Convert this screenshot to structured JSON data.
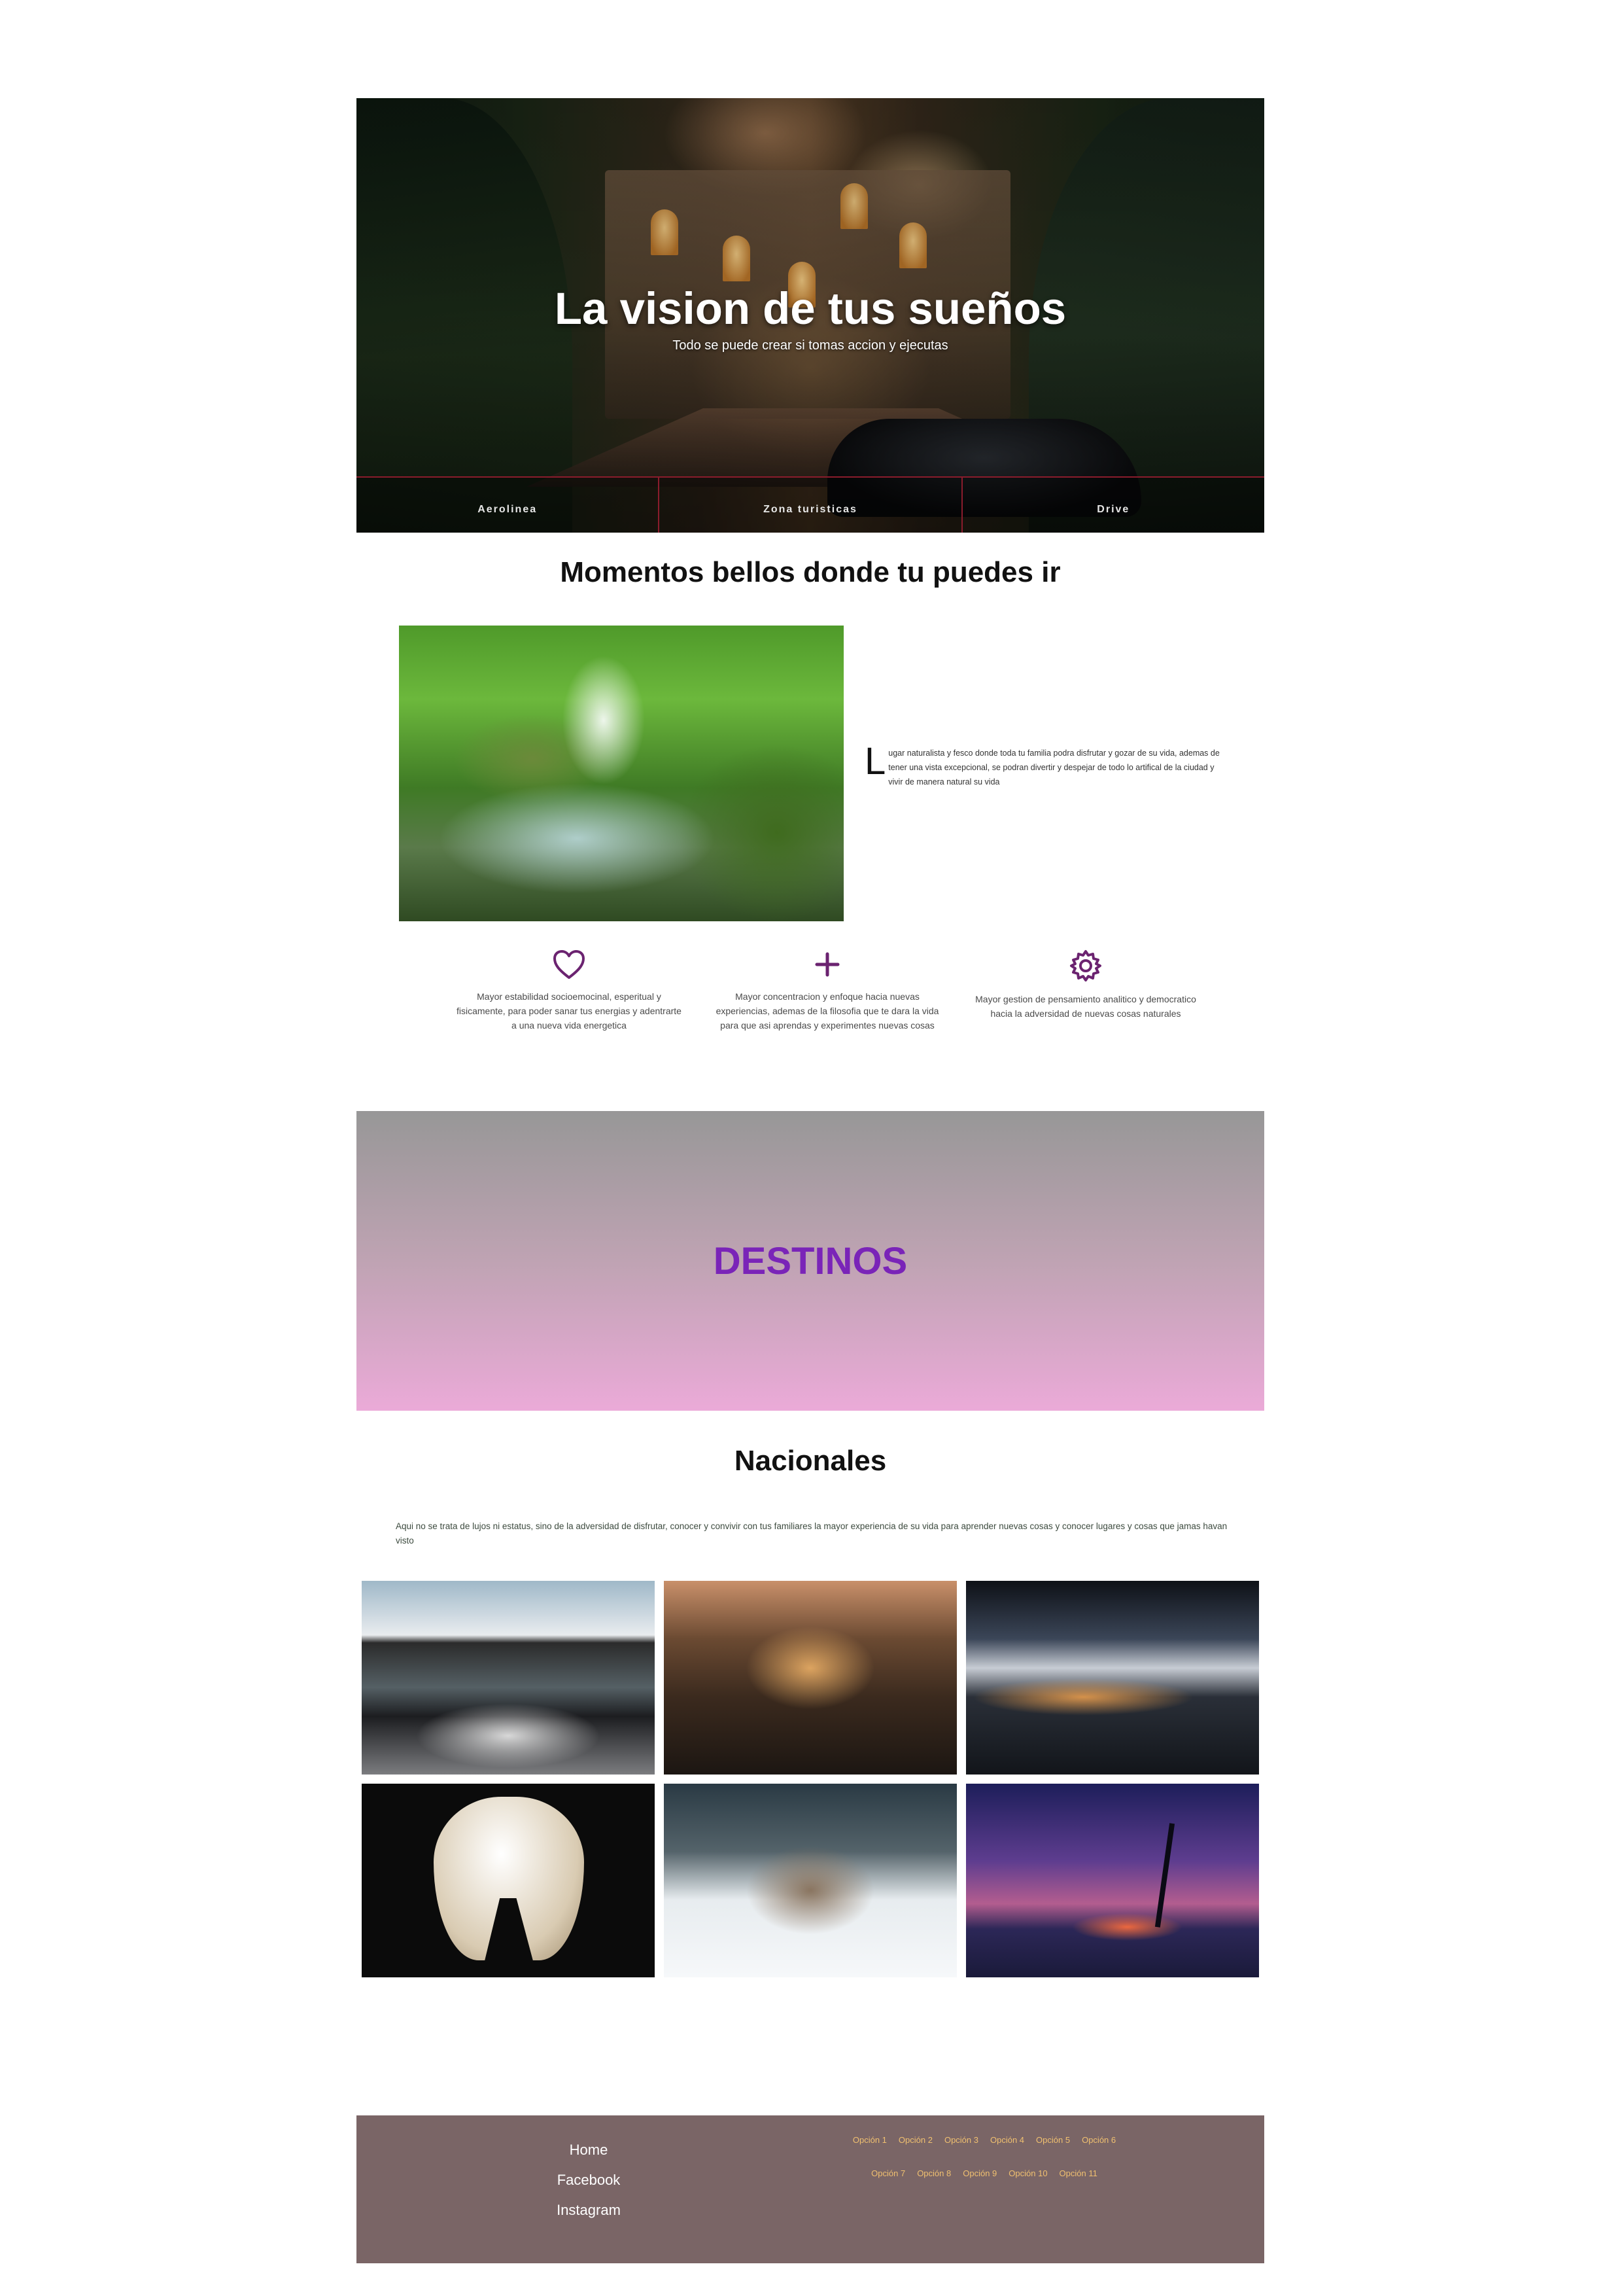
{
  "hero": {
    "title": "La vision de tus sueños",
    "subtitle": "Todo se puede crear si tomas accion y ejecutas",
    "nav": [
      "Aerolinea",
      "Zona turisticas",
      "Drive"
    ]
  },
  "momentos": {
    "title": "Momentos bellos donde tu puedes ir",
    "dropcap": "L",
    "text": "ugar naturalista y fesco donde toda tu familia podra disfrutar y gozar de su vida, ademas de tener una vista excepcional, se podran divertir y despejar de todo lo artifical de la ciudad y vivir de manera natural su vida"
  },
  "features": [
    {
      "icon": "heart-icon",
      "text": "Mayor estabilidad socioemocinal, esperitual y fisicamente, para poder sanar tus energias y adentrarte a una nueva vida energetica"
    },
    {
      "icon": "plus-icon",
      "text": "Mayor concentracion y enfoque hacia nuevas experiencias, ademas de la filosofia que te dara la vida para que asi aprendas y experimentes nuevas cosas"
    },
    {
      "icon": "gear-icon",
      "text": "Mayor gestion de pensamiento analitico y democratico hacia la adversidad de nuevas cosas naturales"
    }
  ],
  "destinos": {
    "title": "DESTINOS"
  },
  "nacionales": {
    "title": "Nacionales",
    "text": "Aqui no se trata de lujos ni estatus, sino de la adversidad de disfrutar, conocer y convivir con tus familiares la mayor experiencia de su vida para aprender nuevas cosas y conocer lugares y cosas que jamas havan visto"
  },
  "footer": {
    "links": [
      "Home",
      "Facebook",
      "Instagram"
    ],
    "options_row1": [
      "Opción 1",
      "Opción 2",
      "Opción 3",
      "Opción 4",
      "Opción 5",
      "Opción 6"
    ],
    "options_row2": [
      "Opción 7",
      "Opción 8",
      "Opción 9",
      "Opción 10",
      "Opción 11"
    ]
  },
  "colors": {
    "accent_purple": "#7a24b8",
    "icon_purple": "#6b2370",
    "footer_bg": "#7a6566",
    "footer_option": "#f0c070",
    "nav_divider": "#8a1c2c"
  }
}
